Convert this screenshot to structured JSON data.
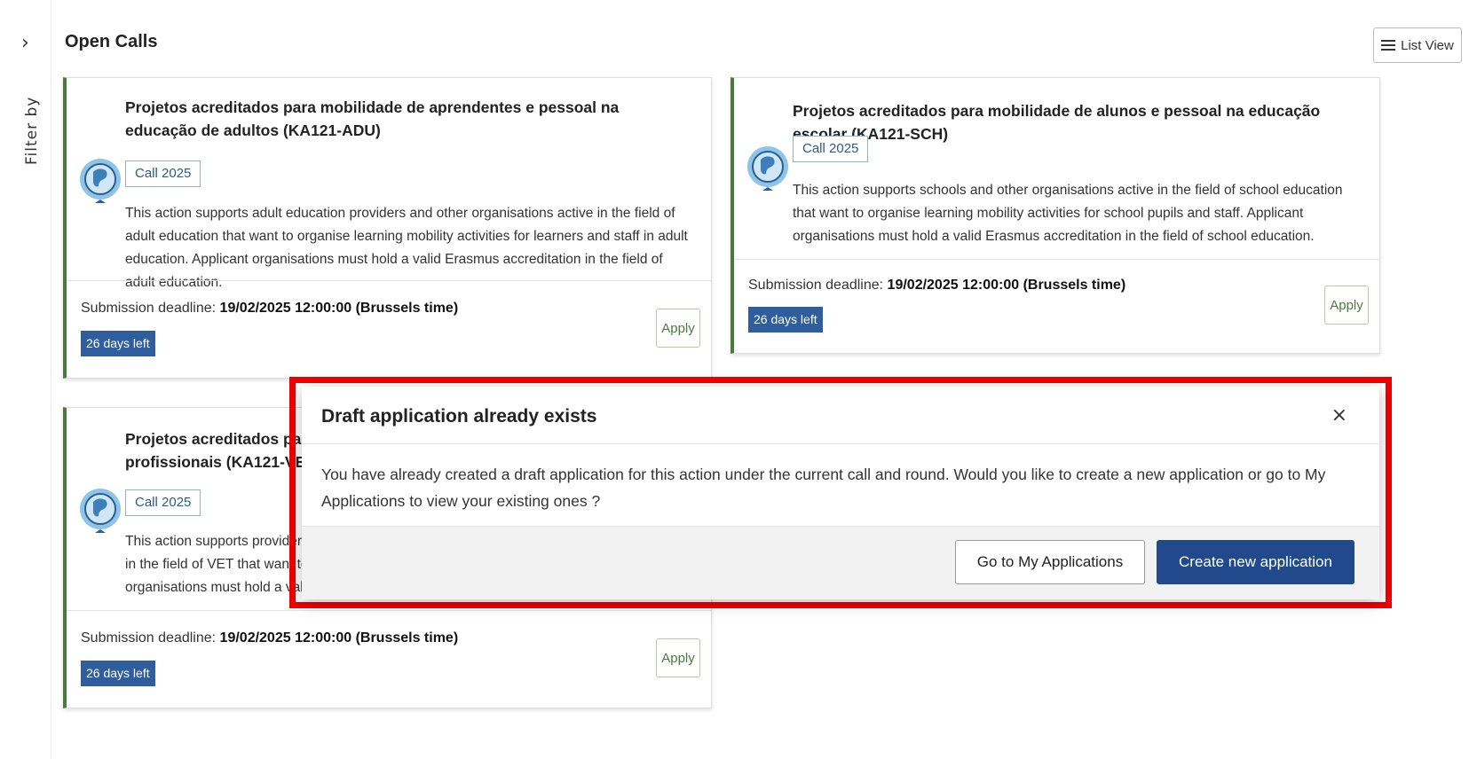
{
  "rail": {
    "toggle": "›",
    "label": "Filter by"
  },
  "header": {
    "title": "Open Calls",
    "list_view_label": "List View"
  },
  "cards": [
    {
      "title": "Projetos acreditados para mobilidade de aprendentes e pessoal na educação de adultos (KA121-ADU)",
      "badge": "Call 2025",
      "description": "This action supports adult education providers and other organisations active in the field of adult education that want to organise learning mobility activities for learners and staff in adult education. Applicant organisations must hold a valid Erasmus accreditation in the field of adult education.",
      "deadline_label": "Submission deadline: ",
      "deadline_value": "19/02/2025 12:00:00 (Brussels time)",
      "days_left": "26 days left",
      "apply_label": "Apply"
    },
    {
      "title": "Projetos acreditados para mobilidade de alunos e pessoal na educação escolar (KA121-SCH)",
      "badge": "Call 2025",
      "description": "This action supports schools and other organisations active in the field of school education that want to organise learning mobility activities for school pupils and staff. Applicant organisations must hold a valid Erasmus accreditation in the field of school education.",
      "deadline_label": "Submission deadline: ",
      "deadline_value": "19/02/2025 12:00:00 (Brussels time)",
      "days_left": "26 days left",
      "apply_label": "Apply"
    },
    {
      "title_line1": "Projetos acreditados para m",
      "title_line2": "profissionais (KA121-VET)",
      "badge": "Call 2025",
      "desc_line1": "This action supports providers",
      "desc_line2": "in the field of VET that want to",
      "desc_line3": "organisations must hold a valid",
      "deadline_label": "Submission deadline: ",
      "deadline_value": "19/02/2025 12:00:00 (Brussels time)",
      "days_left": "26 days left",
      "apply_label": "Apply"
    }
  ],
  "modal": {
    "title": "Draft application already exists",
    "close": "×",
    "message": "You have already created a draft application for this action under the current call and round. Would you like to create a new application or go to My Applications to view your existing ones ?",
    "secondary_button": "Go to My Applications",
    "primary_button": "Create new application"
  },
  "colors": {
    "accent_green": "#4b7a3c",
    "days_badge": "#2e5e9e",
    "primary_button": "#204a8c",
    "highlight": "#ee0000"
  }
}
